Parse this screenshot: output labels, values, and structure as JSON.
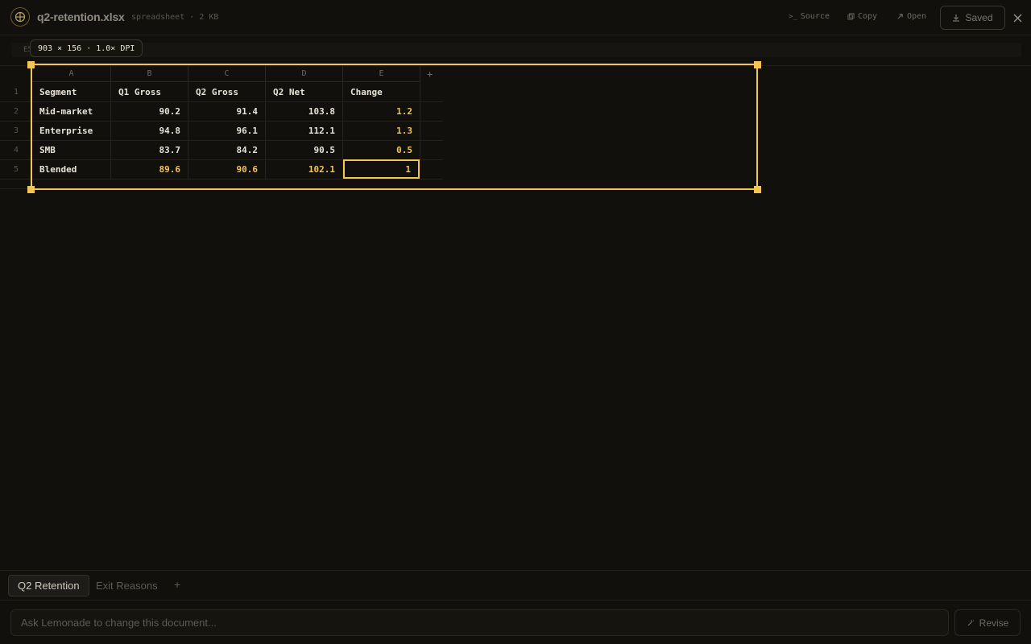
{
  "header": {
    "title": "q2-retention.xlsx",
    "meta": "spreadsheet · 2 KB",
    "source_label": "Source",
    "copy_label": "Copy",
    "open_label": "Open",
    "saved_label": "Saved"
  },
  "formula_bar": {
    "cell_ref": "E5"
  },
  "capture": {
    "dimensions": "903 × 156 · 1.0× DPI"
  },
  "sheet": {
    "columns": [
      "A",
      "B",
      "C",
      "D",
      "E"
    ],
    "row_numbers": [
      "1",
      "2",
      "3",
      "4",
      "5"
    ],
    "rows": [
      [
        "Segment",
        "Q1 Gross",
        "Q2 Gross",
        "Q2 Net",
        "Change"
      ],
      [
        "Mid-market",
        "90.2",
        "91.4",
        "103.8",
        "1.2"
      ],
      [
        "Enterprise",
        "94.8",
        "96.1",
        "112.1",
        "1.3"
      ],
      [
        "SMB",
        "83.7",
        "84.2",
        "90.5",
        "0.5"
      ],
      [
        "Blended",
        "89.6",
        "90.6",
        "102.1",
        "1"
      ]
    ],
    "add_column": "+"
  },
  "tabs": [
    {
      "label": "Q2 Retention",
      "active": true
    },
    {
      "label": "Exit Reasons",
      "active": false
    }
  ],
  "tab_add": "+",
  "prompt": {
    "placeholder": "Ask Lemonade to change this document...",
    "revise_label": "Revise"
  },
  "colors": {
    "accent": "#f2c650",
    "background": "#11100d"
  }
}
